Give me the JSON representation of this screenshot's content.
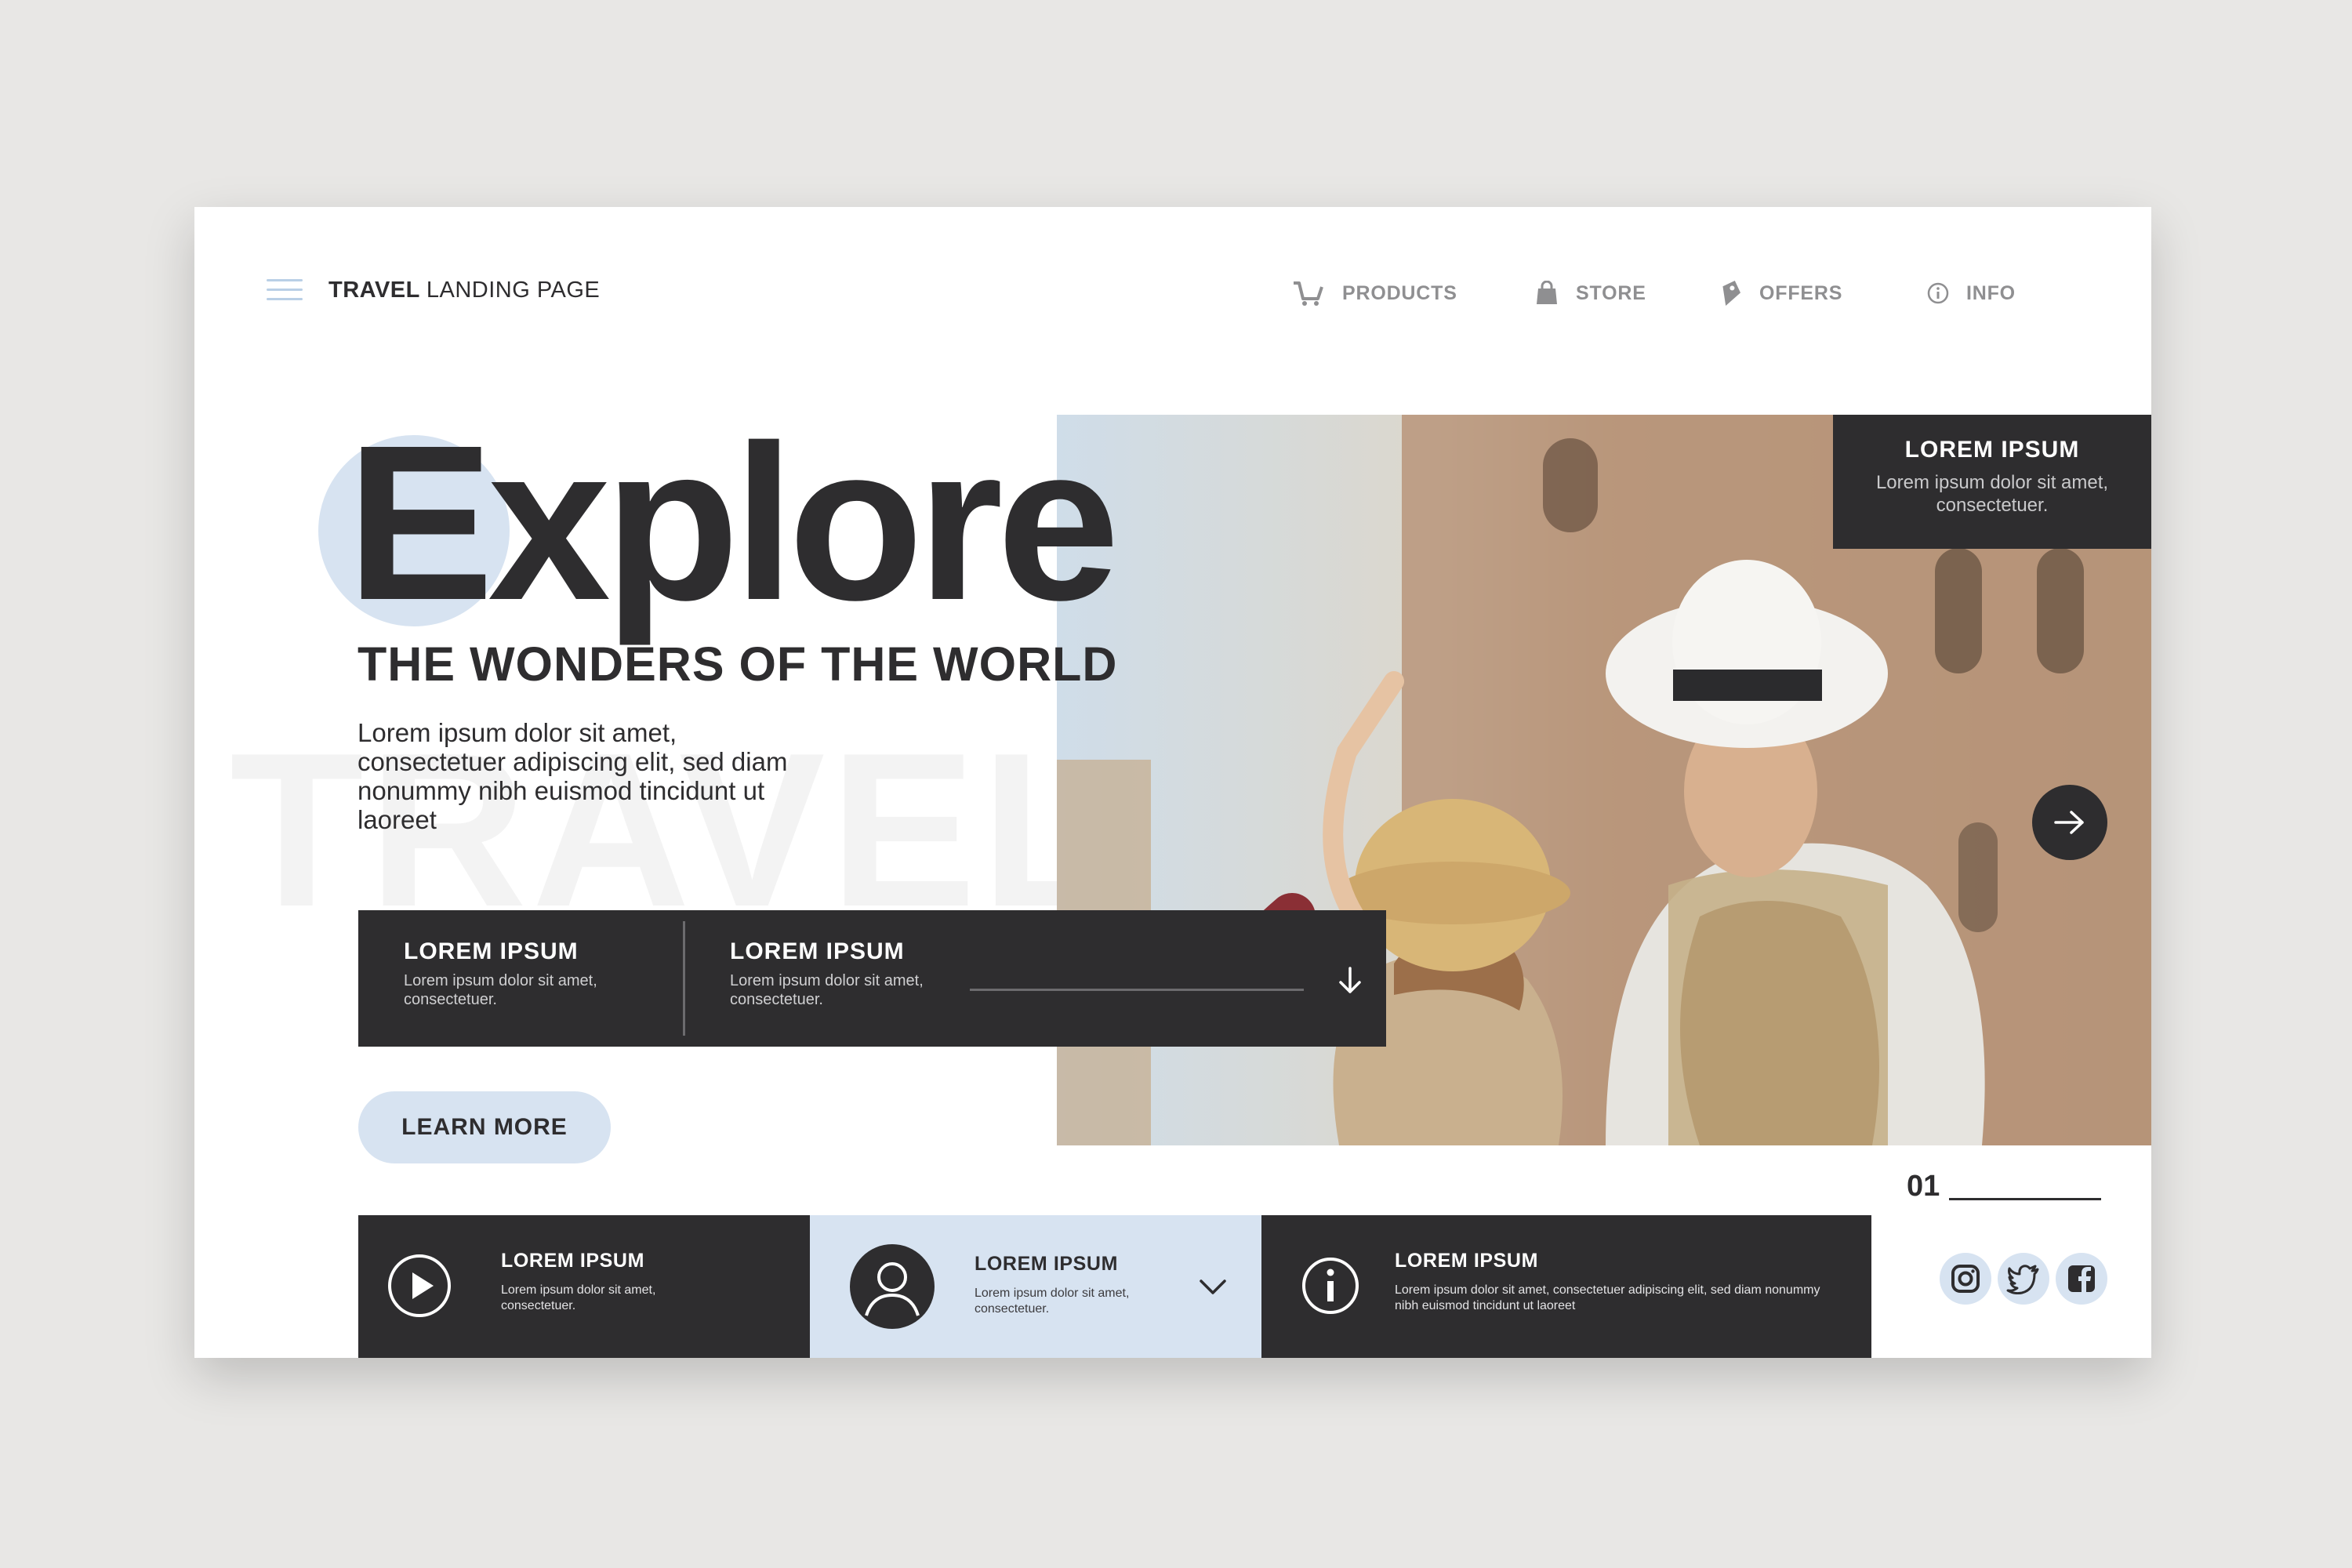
{
  "header": {
    "brand_bold": "TRAVEL",
    "brand_rest": "LANDING PAGE",
    "nav": [
      {
        "label": "PRODUCTS",
        "icon": "cart-icon"
      },
      {
        "label": "STORE",
        "icon": "shopping-bag-icon"
      },
      {
        "label": "OFFERS",
        "icon": "tag-icon"
      },
      {
        "label": "INFO",
        "icon": "info-icon"
      }
    ]
  },
  "hero": {
    "title": "Explore",
    "subtitle": "THE WONDERS OF THE WORLD",
    "watermark": "TRAVEL",
    "lead": "Lorem ipsum dolor sit amet, consectetuer adipiscing elit, sed diam nonummy nibh euismod tincidunt ut laoreet",
    "learn_more": "LEARN MORE"
  },
  "photo_card": {
    "title": "LOREM IPSUM",
    "text": "Lorem ipsum dolor sit amet, consectetuer."
  },
  "info_strip": [
    {
      "title": "LOREM IPSUM",
      "text": "Lorem ipsum dolor sit amet, consectetuer."
    },
    {
      "title": "LOREM IPSUM",
      "text": "Lorem ipsum dolor sit amet, consectetuer."
    }
  ],
  "pager": {
    "current": "01"
  },
  "bottom_bar": [
    {
      "title": "LOREM IPSUM",
      "text": "Lorem ipsum dolor sit amet, consectetuer.",
      "icon": "play-icon"
    },
    {
      "title": "LOREM IPSUM",
      "text": "Lorem ipsum dolor sit amet, consectetuer.",
      "icon": "user-icon"
    },
    {
      "title": "LOREM IPSUM",
      "text": "Lorem ipsum dolor sit amet, consectetuer adipiscing elit, sed diam nonummy nibh euismod tincidunt ut laoreet",
      "icon": "info-icon"
    }
  ],
  "social": [
    "instagram-icon",
    "twitter-icon",
    "facebook-icon"
  ],
  "colors": {
    "background": "#e8e7e5",
    "dark": "#2e2d2f",
    "accent_light_blue": "#d7e3f1",
    "nav_gray": "#8f8f91"
  }
}
